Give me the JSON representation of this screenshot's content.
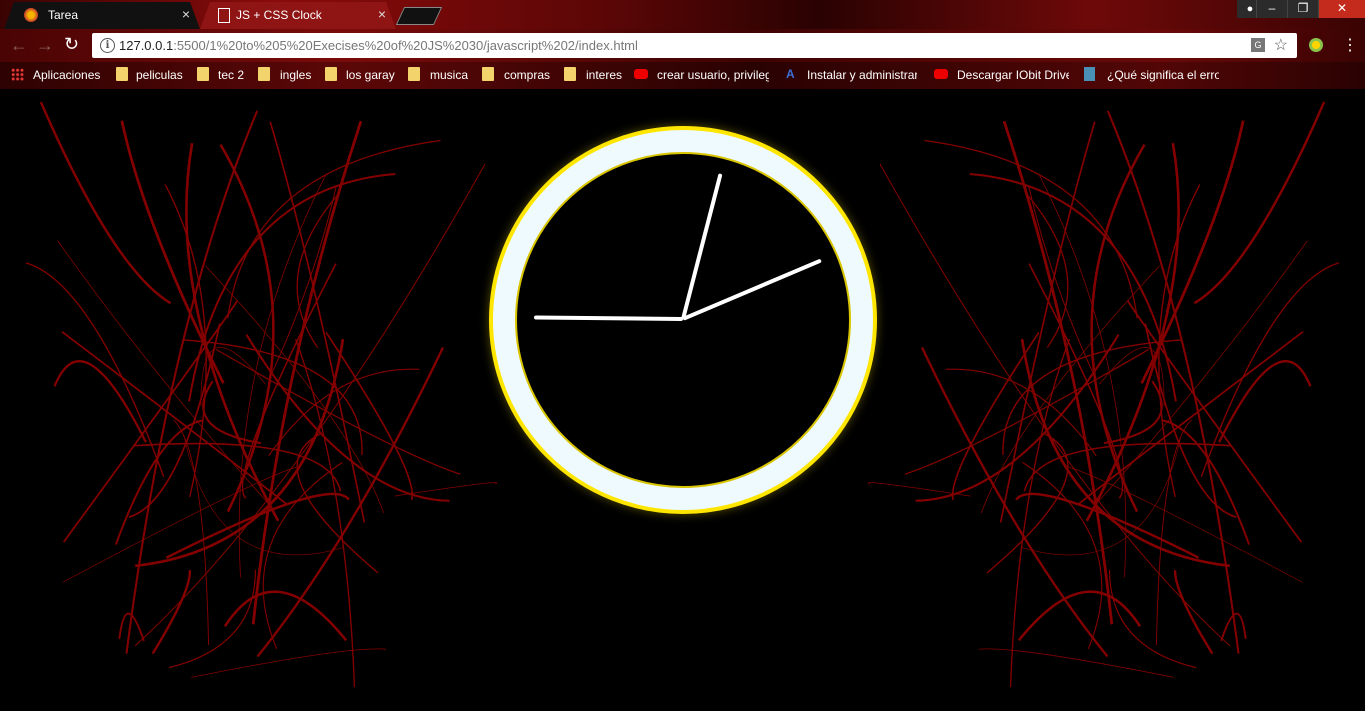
{
  "browser": {
    "tabs": [
      {
        "title": "Tarea",
        "active": false,
        "favicon": "tarea-favicon-icon"
      },
      {
        "title": "JS + CSS Clock",
        "active": true,
        "favicon": "page-icon"
      }
    ],
    "tab_close_glyph": "×",
    "window_buttons": {
      "minimize": "–",
      "restore": "❐",
      "close": "✕"
    },
    "url": {
      "host": "127.0.0.1",
      "path": ":5500/1%20to%205%20Execises%20of%20JS%2030/javascript%202/index.html"
    },
    "bookmarks": [
      {
        "label": "Aplicaciones",
        "icon": "apps-grid-icon"
      },
      {
        "label": "peliculas",
        "icon": "folder-icon"
      },
      {
        "label": "tec 2",
        "icon": "folder-icon"
      },
      {
        "label": "ingles",
        "icon": "folder-icon"
      },
      {
        "label": "los garay",
        "icon": "folder-icon"
      },
      {
        "label": "musica",
        "icon": "folder-icon"
      },
      {
        "label": "compras",
        "icon": "folder-icon"
      },
      {
        "label": "interes",
        "icon": "folder-icon"
      },
      {
        "label": "crear usuario, privileg",
        "icon": "youtube-icon"
      },
      {
        "label": "Instalar y administrar",
        "icon": "site-icon"
      },
      {
        "label": "Descargar IObit Drive",
        "icon": "youtube-icon"
      },
      {
        "label": "¿Qué significa el error",
        "icon": "site-icon"
      }
    ]
  },
  "clock": {
    "hour_hand_angle_deg": 180.6,
    "minute_hand_angle_deg": 67,
    "second_hand_angle_deg": 14.5,
    "colors": {
      "face_ring": "#eefafd",
      "border": "#ffe600",
      "hands": "#ffffff",
      "center": "#000000"
    }
  },
  "colors": {
    "background_accent": "#b00000"
  }
}
